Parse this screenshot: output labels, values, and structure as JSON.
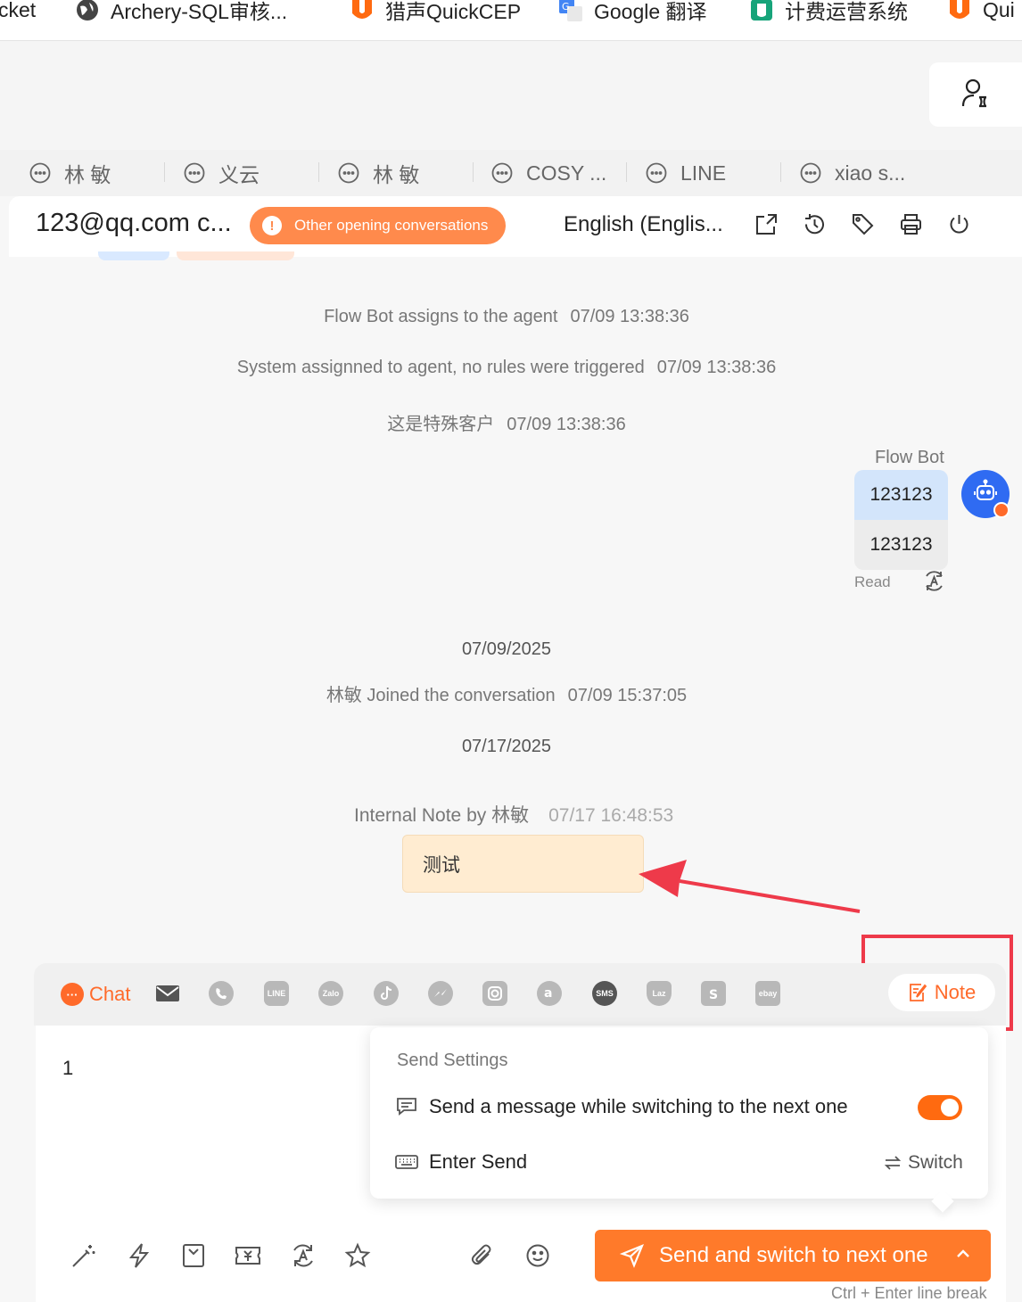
{
  "bookmarks": [
    {
      "label": "cket",
      "icon": "none"
    },
    {
      "label": "Archery-SQL审核...",
      "icon": "globe-icon"
    },
    {
      "label": "猎声QuickCEP",
      "icon": "u-logo-icon"
    },
    {
      "label": "Google 翻译",
      "icon": "google-translate-icon"
    },
    {
      "label": "计费运营系统",
      "icon": "shield-logo-icon"
    },
    {
      "label": "Qui",
      "icon": "u-logo-icon"
    }
  ],
  "tabs": [
    {
      "label": "林 敏"
    },
    {
      "label": "义云"
    },
    {
      "label": "林 敏"
    },
    {
      "label": "COSY ..."
    },
    {
      "label": "LINE"
    },
    {
      "label": "xiao s..."
    }
  ],
  "header": {
    "title": "123@qq.com c...",
    "warning": "Other opening conversations",
    "language": "English (Englis..."
  },
  "messages": {
    "system1": {
      "text": "Flow Bot assigns to the agent",
      "time": "07/09 13:38:36"
    },
    "system2": {
      "text": "System assignned to agent, no rules were triggered",
      "time": "07/09 13:38:36"
    },
    "system3": {
      "text": "这是特殊客户",
      "time": "07/09 13:38:36"
    },
    "bot_name": "Flow Bot",
    "bubble1": "123123",
    "bubble2": "123123",
    "read": "Read",
    "date1": "07/09/2025",
    "joined": {
      "text": "林敏 Joined the conversation",
      "time": "07/09 15:37:05"
    },
    "date2": "07/17/2025",
    "note_head": {
      "text": "Internal Note by 林敏",
      "time": "07/17 16:48:53"
    },
    "note_text": "测试"
  },
  "composer": {
    "chat_label": "Chat",
    "note_label": "Note",
    "input_value": "1",
    "send_label": "Send and switch to next one",
    "hint": "Ctrl + Enter line break"
  },
  "send_settings": {
    "title": "Send Settings",
    "row1": "Send a message while switching to the next one",
    "row1_enabled": true,
    "row2": "Enter Send",
    "switch_label": "Switch"
  },
  "colors": {
    "accent": "#ff7a2a",
    "annotation": "#ee3a4a",
    "bot_blue": "#2f6bf2"
  }
}
